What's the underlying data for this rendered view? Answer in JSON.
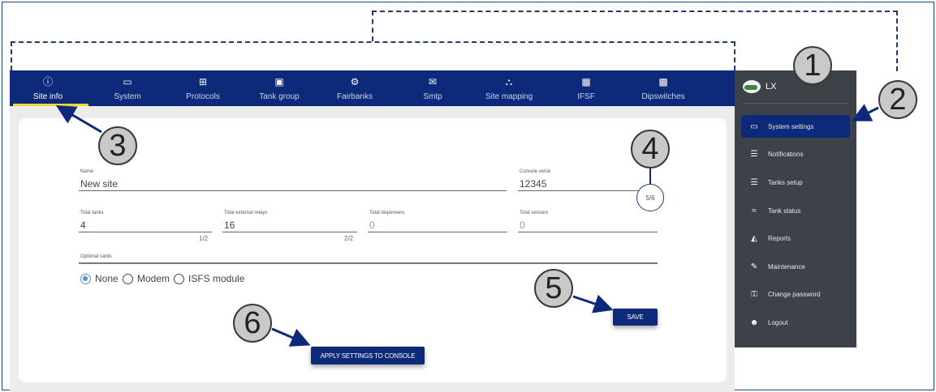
{
  "tabs": [
    {
      "label": "Site info",
      "icon": "info-icon",
      "glyph": "ⓘ",
      "active": true
    },
    {
      "label": "System",
      "icon": "laptop-icon",
      "glyph": "▭"
    },
    {
      "label": "Protocols",
      "icon": "protocols-icon",
      "glyph": "⊞"
    },
    {
      "label": "Tank group",
      "icon": "tank-group-icon",
      "glyph": "▣"
    },
    {
      "label": "Fairbanks",
      "icon": "fairbanks-icon",
      "glyph": "⚙"
    },
    {
      "label": "Smtp",
      "icon": "mail-icon",
      "glyph": "✉"
    },
    {
      "label": "Site mapping",
      "icon": "sitemap-icon",
      "glyph": "⛬"
    },
    {
      "label": "IFSF",
      "icon": "ifsf-icon",
      "glyph": "▦"
    },
    {
      "label": "Dipswitches",
      "icon": "dipswitch-icon",
      "glyph": "▩"
    }
  ],
  "form": {
    "name": {
      "label": "Name",
      "value": "New site"
    },
    "console_serial": {
      "label": "Console serial",
      "value": "12345",
      "counter": "5/6"
    },
    "total_tanks": {
      "label": "Total tanks",
      "value": "4",
      "counter": "1/2"
    },
    "total_external_relays": {
      "label": "Total external relays",
      "value": "16",
      "counter": "2/2"
    },
    "total_dispensers": {
      "label": "Total dispensers",
      "value": "0"
    },
    "total_sensors": {
      "label": "Total sensors",
      "value": "0"
    },
    "optional_cards": {
      "label": "Optional cards",
      "options": [
        "None",
        "Modem",
        "ISFS module"
      ],
      "selected": "None"
    }
  },
  "buttons": {
    "save": "SAVE",
    "apply": "APPLY SETTINGS TO CONSOLE"
  },
  "sidebar": {
    "user": "LX",
    "items": [
      {
        "label": "System settings",
        "icon": "monitor-icon",
        "glyph": "▭",
        "active": true
      },
      {
        "label": "Notifications",
        "icon": "notifications-icon",
        "glyph": "☰"
      },
      {
        "label": "Tanks setup",
        "icon": "database-icon",
        "glyph": "☰"
      },
      {
        "label": "Tank status",
        "icon": "waves-icon",
        "glyph": "≈"
      },
      {
        "label": "Reports",
        "icon": "chart-icon",
        "glyph": "◭"
      },
      {
        "label": "Maintenance",
        "icon": "wrench-icon",
        "glyph": "✎"
      },
      {
        "label": "Change password",
        "icon": "key-icon",
        "glyph": "⚿"
      },
      {
        "label": "Logout",
        "icon": "logout-icon",
        "glyph": "☻"
      }
    ]
  },
  "callouts": [
    "1",
    "2",
    "3",
    "4",
    "5",
    "6"
  ],
  "colors": {
    "nav": "#0d2a7a",
    "sidebar": "#3d4148",
    "accent": "#f1d638",
    "radio": "#5a8fd6"
  }
}
